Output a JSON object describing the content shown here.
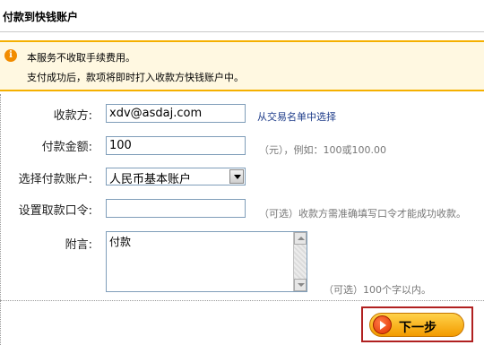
{
  "header": {
    "title": "付款到快钱账户"
  },
  "notice": {
    "icon": "info-icon",
    "line1": "本服务不收取手续费用。",
    "line2": "支付成功后，款项将即时打入收款方快钱账户中。"
  },
  "form": {
    "payee": {
      "label": "收款方:",
      "value": "xdv@asdaj.com",
      "link": "从交易名单中选择"
    },
    "amount": {
      "label": "付款金额:",
      "value": "100",
      "hint": "（元），例如：100或100.00"
    },
    "account": {
      "label": "选择付款账户:",
      "selected": "人民币基本账户"
    },
    "code": {
      "label": "设置取款口令:",
      "value": "",
      "hint": "（可选）收款方需准确填写口令才能成功收款。"
    },
    "remark": {
      "label": "附言:",
      "value": "付款",
      "hint": "（可选）100个字以内。"
    }
  },
  "actions": {
    "next_label": "下一步"
  },
  "colors": {
    "accent": "#f5b000",
    "button": "#f39b00",
    "frame": "#b02020",
    "link": "#1f3d8a"
  }
}
